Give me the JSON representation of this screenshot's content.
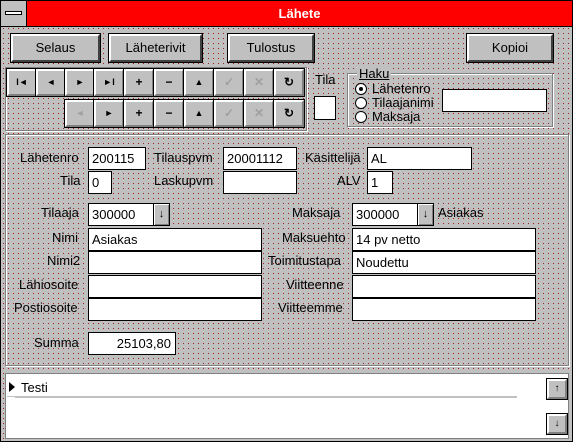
{
  "window": {
    "title": "Lähete"
  },
  "toolbar": {
    "browse_label": "Selaus",
    "rows_label": "Läheterivit",
    "print_label": "Tulostus",
    "copy_label": "Kopioi"
  },
  "nav": {
    "first": "I◄",
    "prev": "◄",
    "next": "►",
    "last": "►I",
    "add": "+",
    "remove": "−",
    "up": "▲",
    "ok": "✓",
    "cancel": "✕",
    "refresh": "↻"
  },
  "tila_box": {
    "label": "Tila",
    "checked": false
  },
  "search": {
    "group_label": "Haku",
    "options": [
      "Lähetenro",
      "Tilaajanimi",
      "Maksaja"
    ],
    "selected": "Lähetenro",
    "value": ""
  },
  "header_fields": {
    "lahetenro_label": "Lähetenro",
    "lahetenro": "200115",
    "tilauspvm_label": "Tilauspvm",
    "tilauspvm": "20001112",
    "kasittelija_label": "Käsittelijä",
    "kasittelija": "AL",
    "tila_label": "Tila",
    "tila": "0",
    "laskupvm_label": "Laskupvm",
    "laskupvm": "",
    "alv_label": "ALV",
    "alv": "1"
  },
  "customer": {
    "tilaaja_label": "Tilaaja",
    "tilaaja": "300000",
    "nimi_label": "Nimi",
    "nimi": "Asiakas",
    "nimi2_label": "Nimi2",
    "nimi2": "",
    "lahiosoite_label": "Lähiosoite",
    "lahiosoite": "",
    "postiosoite_label": "Postiosoite",
    "postiosoite": "",
    "summa_label": "Summa",
    "summa": "25103,80"
  },
  "payer": {
    "maksaja_label": "Maksaja",
    "maksaja": "300000",
    "maksaja_suffix": "Asiakas",
    "maksuehto_label": "Maksuehto",
    "maksuehto": "14 pv netto",
    "toimitustapa_label": "Toimitustapa",
    "toimitustapa": "Noudettu",
    "viitteenne_label": "Viitteenne",
    "viitteenne": "",
    "viitteemme_label": "Viitteemme",
    "viitteemme": ""
  },
  "notes": {
    "text": "Testi"
  },
  "colors": {
    "titlebar": "#ff0000",
    "face": "#c0c0c0"
  }
}
